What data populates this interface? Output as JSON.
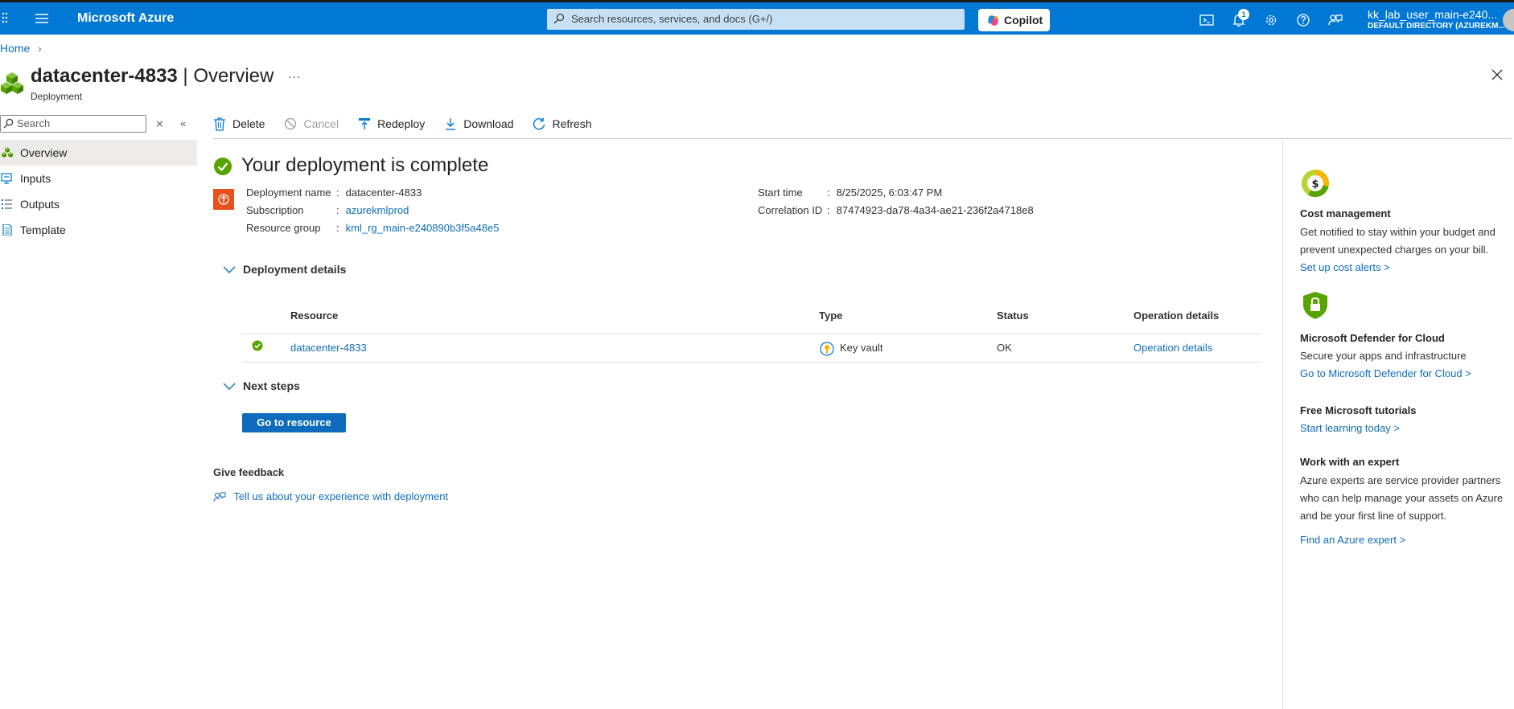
{
  "topbar": {
    "brand": "Microsoft Azure",
    "search_placeholder": "Search resources, services, and docs (G+/)",
    "copilot_label": "Copilot",
    "notification_count": "1",
    "user_name": "kk_lab_user_main-e240...",
    "directory": "DEFAULT DIRECTORY (AZUREKM..."
  },
  "breadcrumb": {
    "home": "Home"
  },
  "header": {
    "resource_name": "datacenter-4833",
    "separator_title": " | Overview",
    "subtitle": "Deployment",
    "more": "..."
  },
  "nav": {
    "search_placeholder": "Search",
    "items": [
      {
        "label": "Overview",
        "icon": "deployment-icon",
        "active": true
      },
      {
        "label": "Inputs",
        "icon": "inputs-icon"
      },
      {
        "label": "Outputs",
        "icon": "outputs-icon"
      },
      {
        "label": "Template",
        "icon": "template-icon"
      }
    ]
  },
  "toolbar": {
    "delete": "Delete",
    "cancel": "Cancel",
    "redeploy": "Redeploy",
    "download": "Download",
    "refresh": "Refresh"
  },
  "main": {
    "status_title": "Your deployment is complete",
    "fields": {
      "deployment_name_label": "Deployment name",
      "deployment_name": "datacenter-4833",
      "subscription_label": "Subscription",
      "subscription": "azurekmlprod",
      "resource_group_label": "Resource group",
      "resource_group": "kml_rg_main-e240890b3f5a48e5",
      "start_time_label": "Start time",
      "start_time": "8/25/2025, 6:03:47 PM",
      "correlation_label": "Correlation ID",
      "correlation_id": "87474923-da78-4a34-ae21-236f2a4718e8",
      "colon": ":"
    },
    "deployment_details_label": "Deployment details",
    "table": {
      "headers": {
        "resource": "Resource",
        "type": "Type",
        "status": "Status",
        "operation": "Operation details"
      },
      "rows": [
        {
          "resource": "datacenter-4833",
          "type": "Key vault",
          "status": "OK",
          "operation": "Operation details"
        }
      ]
    },
    "next_steps_label": "Next steps",
    "go_to_resource": "Go to resource",
    "feedback_heading": "Give feedback",
    "feedback_link": "Tell us about your experience with deployment"
  },
  "right_panel": {
    "cost": {
      "title": "Cost management",
      "body": "Get notified to stay within your budget and prevent unexpected charges on your bill.",
      "link": "Set up cost alerts >"
    },
    "defender": {
      "title": "Microsoft Defender for Cloud",
      "body": "Secure your apps and infrastructure",
      "link": "Go to Microsoft Defender for Cloud >"
    },
    "tutorials": {
      "title": "Free Microsoft tutorials",
      "link": "Start learning today >"
    },
    "expert": {
      "title": "Work with an expert",
      "body": "Azure experts are service provider partners who can help manage your assets on Azure and be your first line of support.",
      "link": "Find an Azure expert >"
    }
  },
  "colors": {
    "brand_blue": "#0078d4",
    "link_blue": "#0f6cbd",
    "success_green": "#57a300",
    "deploy_orange": "#e8501d"
  }
}
